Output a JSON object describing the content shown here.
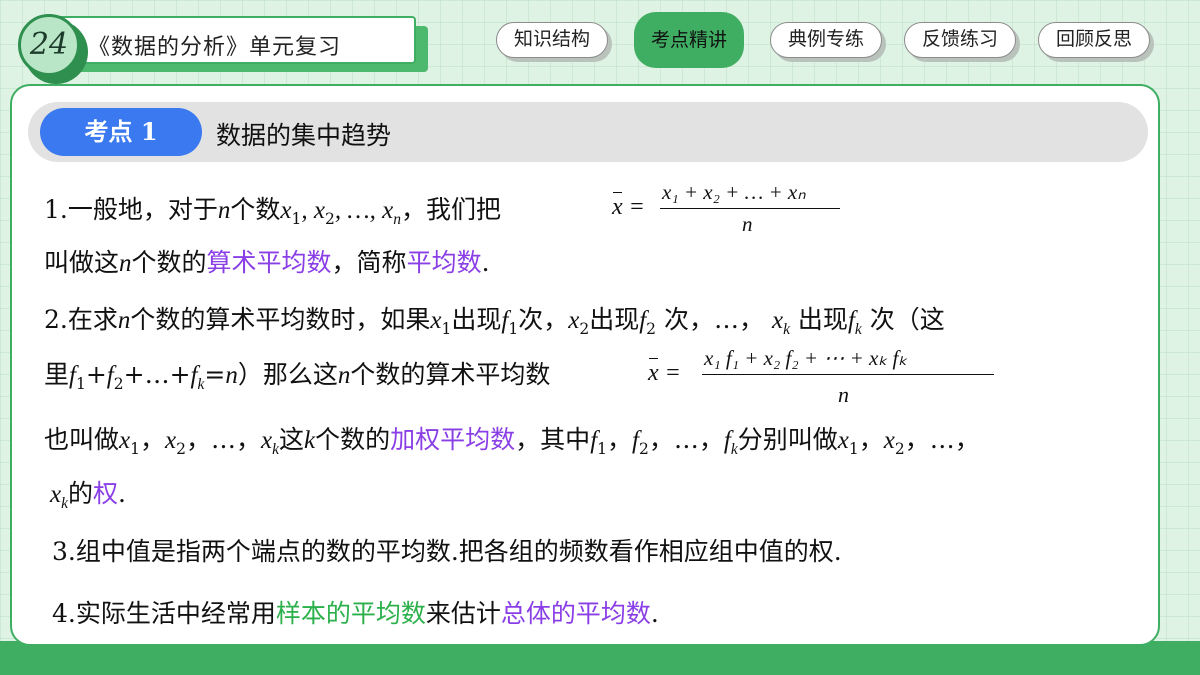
{
  "header": {
    "lesson_number": "24",
    "lesson_title": "《数据的分析》单元复习",
    "tabs": [
      {
        "label": "知识结构"
      },
      {
        "label": "考点精讲",
        "active": true
      },
      {
        "label": "典例专练"
      },
      {
        "label": "反馈练习"
      },
      {
        "label": "回顾反思"
      }
    ]
  },
  "topic": {
    "badge": "考点 1",
    "title": "数据的集中趋势"
  },
  "content": {
    "p1": {
      "a": "1.一般地，对于",
      "n": "n",
      "b": "个数",
      "x1": "x",
      "sep1": ", ",
      "x2": "x",
      "sep2": ", …, ",
      "xn": "x",
      "c": "，我们把",
      "formula_lhs": "= ",
      "formula_num": "x₁ + x₂ + … + xₙ",
      "formula_den": "n"
    },
    "p1b": {
      "a": "叫做这",
      "n": "n",
      "b": "个数的",
      "term1": "算术平均数",
      "c": "，简称",
      "term2": "平均数",
      "d": "."
    },
    "p2": {
      "a": "2.在求",
      "b": "个数的算术平均数时，如果",
      "c": "出现",
      "d": "次，",
      "e": "出现",
      "f": "次，…，",
      "g": "出现",
      "h": "次（这"
    },
    "p2b": {
      "a": "里",
      "b": "）那么这",
      "c": "个数的算术平均数",
      "formula_lhs": "= ",
      "formula_num": "x₁ f₁ + x₂ f₂ + ⋯ + xₖ fₖ",
      "formula_den": "n"
    },
    "p2c": {
      "a": "也叫做",
      "b": "这",
      "k": "k",
      "c": "个数的",
      "term": "加权平均数",
      "d": "，其中",
      "e": "分别叫做"
    },
    "p2d": {
      "a": "的",
      "term": "权",
      "b": "."
    },
    "p3": "3.组中值是指两个端点的数的平均数.把各组的频数看作相应组中值的权.",
    "p4": {
      "a": "4.实际生活中经常用",
      "term1": "样本的平均数",
      "b": "来估计",
      "term2": "总体的平均数",
      "c": "."
    }
  },
  "colors": {
    "accent_green": "#3fae63",
    "badge_blue": "#3a79ef",
    "term_purple": "#8a3fe6",
    "term_green": "#2bb04b"
  }
}
